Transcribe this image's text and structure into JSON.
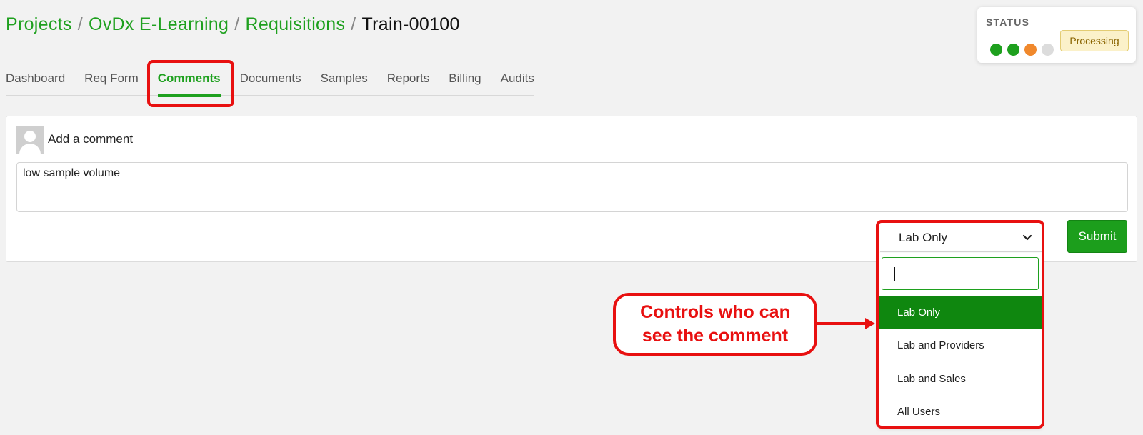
{
  "breadcrumb": {
    "items": [
      "Projects",
      "OvDx E-Learning",
      "Requisitions"
    ],
    "separator": "/",
    "current": "Train-00100"
  },
  "status": {
    "label": "STATUS",
    "dots": [
      "#1ea01e",
      "#1ea01e",
      "#f0882c",
      "#dcdcdc"
    ],
    "badge": "Processing"
  },
  "tabs": [
    {
      "label": "Dashboard",
      "active": false
    },
    {
      "label": "Req Form",
      "active": false
    },
    {
      "label": "Comments",
      "active": true
    },
    {
      "label": "Documents",
      "active": false
    },
    {
      "label": "Samples",
      "active": false
    },
    {
      "label": "Reports",
      "active": false
    },
    {
      "label": "Billing",
      "active": false
    },
    {
      "label": "Audits",
      "active": false
    }
  ],
  "comment": {
    "add_label": "Add a comment",
    "text": "low sample volume",
    "visibility_selected": "Lab Only",
    "submit_label": "Submit"
  },
  "dropdown": {
    "search_value": "",
    "options": [
      "Lab Only",
      "Lab and Providers",
      "Lab and Sales",
      "All Users"
    ],
    "selected_index": 0
  },
  "annotation": {
    "callout_line1": "Controls who can",
    "callout_line2": "see the comment",
    "color": "#e81010"
  },
  "colors": {
    "accent": "#1ea01e",
    "selected_option": "#0f870f"
  }
}
